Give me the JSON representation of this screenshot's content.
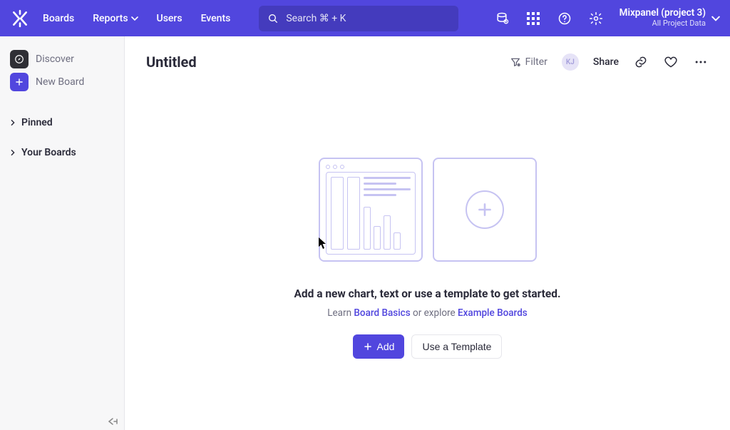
{
  "nav": {
    "links": [
      {
        "label": "Boards"
      },
      {
        "label": "Reports"
      },
      {
        "label": "Users"
      },
      {
        "label": "Events"
      }
    ],
    "search_placeholder": "Search  ⌘ + K",
    "org_title": "Mixpanel (project 3)",
    "org_subtitle": "All Project Data"
  },
  "sidebar": {
    "discover": "Discover",
    "new_board": "New Board",
    "sections": [
      {
        "label": "Pinned"
      },
      {
        "label": "Your Boards"
      }
    ]
  },
  "page": {
    "title": "Untitled",
    "filter": "Filter",
    "share": "Share",
    "avatar_initials": "KJ"
  },
  "empty": {
    "title": "Add a new chart, text or use a template to get started.",
    "learn_prefix": "Learn ",
    "learn_link": "Board Basics",
    "or_explore": " or explore ",
    "example_link": "Example Boards",
    "add": "Add",
    "template": "Use a Template"
  }
}
